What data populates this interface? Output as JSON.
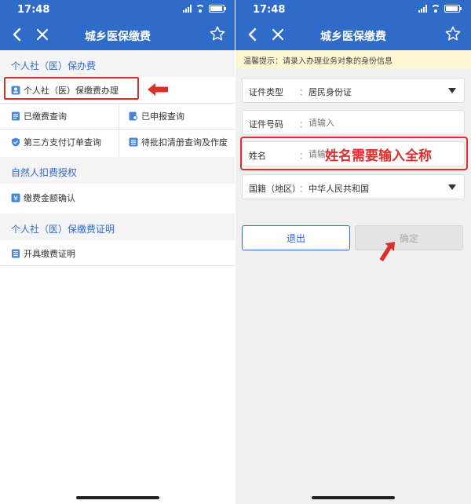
{
  "status": {
    "time": "17:48"
  },
  "header": {
    "title": "城乡医保缴费"
  },
  "left": {
    "sections": [
      {
        "title": "个人社（医）保办费"
      },
      {
        "title": "自然人扣费授权"
      },
      {
        "title": "个人社（医）保缴费证明"
      }
    ],
    "items": {
      "personal_payment": "个人社（医）保缴费办理",
      "paid_query": "已缴费查询",
      "declared_query": "已申报查询",
      "third_party_query": "第三方支付订单查询",
      "pending_batch": "待批扣清册查询及作废",
      "amount_confirm": "缴费金额确认",
      "issue_certificate": "开具缴费证明"
    }
  },
  "right": {
    "notice": "温馨提示：请录入办理业务对象的身份信息",
    "fields": {
      "cert_type": {
        "label": "证件类型",
        "colon": "：",
        "value": "居民身份证"
      },
      "cert_no": {
        "label": "证件号码",
        "colon": "：",
        "placeholder": "请输入"
      },
      "name": {
        "label": "姓名",
        "colon": "：",
        "placeholder": "请输入"
      },
      "nationality": {
        "label": "国籍（地区）",
        "colon": "：",
        "value": "中华人民共和国"
      }
    },
    "annotation": "姓名需要输入全称",
    "buttons": {
      "exit": "退出",
      "confirm": "确定"
    }
  },
  "colors": {
    "header": "#2f6bc9",
    "highlight": "#d9302c",
    "notice_bg": "#fdf7d3"
  }
}
